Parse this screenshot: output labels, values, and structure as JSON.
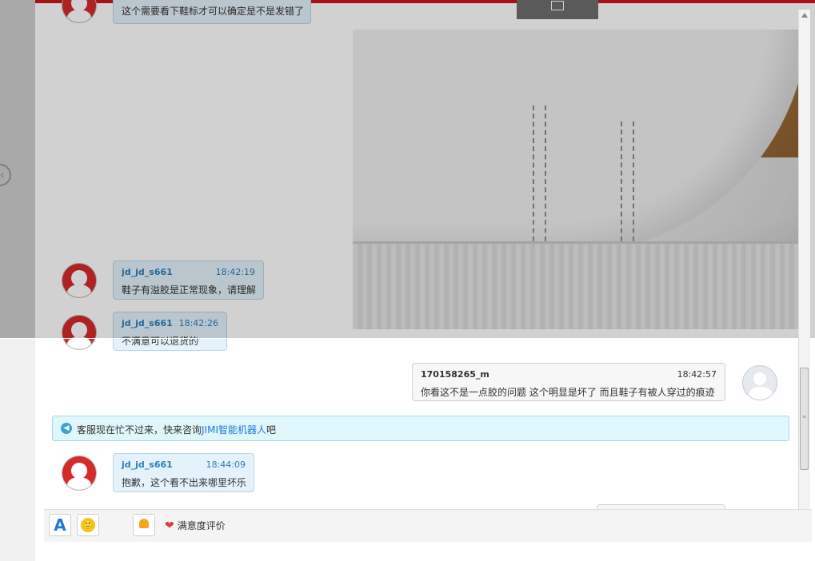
{
  "back_icon": "chevron-left-icon",
  "top_tab_icon": "restore-icon",
  "messages": [
    {
      "id": "m0",
      "text": "这个需要看下鞋标才可以确定是不是发错了"
    },
    {
      "id": "m1",
      "name": "jd_jd_s661",
      "time": "18:42:19",
      "text": "鞋子有溢胶是正常现象，请理解"
    },
    {
      "id": "m2",
      "name": "jd_jd_s661",
      "time": "18:42:26",
      "text": "不满意可以退货的"
    },
    {
      "id": "m3",
      "name": "170158265_m",
      "time": "18:42:57",
      "text": "你看这不是一点胶的问题 这个明显是坏了 而且鞋子有被人穿过的痕迹"
    },
    {
      "id": "m4",
      "name": "jd_jd_s661",
      "time": "18:44:09",
      "text": "抱歉，这个看不出来哪里坏乐"
    }
  ],
  "notice": {
    "prefix": "客服现在忙不过来，快来咨询",
    "link": "JIMI智能机器人",
    "suffix": "吧"
  },
  "toolbar": {
    "font_label": "A",
    "emoji": "🙂",
    "rate_label": "满意度评价"
  },
  "colors": {
    "accent": "#c9161d",
    "agent_bubble": "#e3f2fb",
    "name_blue": "#2d7fb8"
  }
}
